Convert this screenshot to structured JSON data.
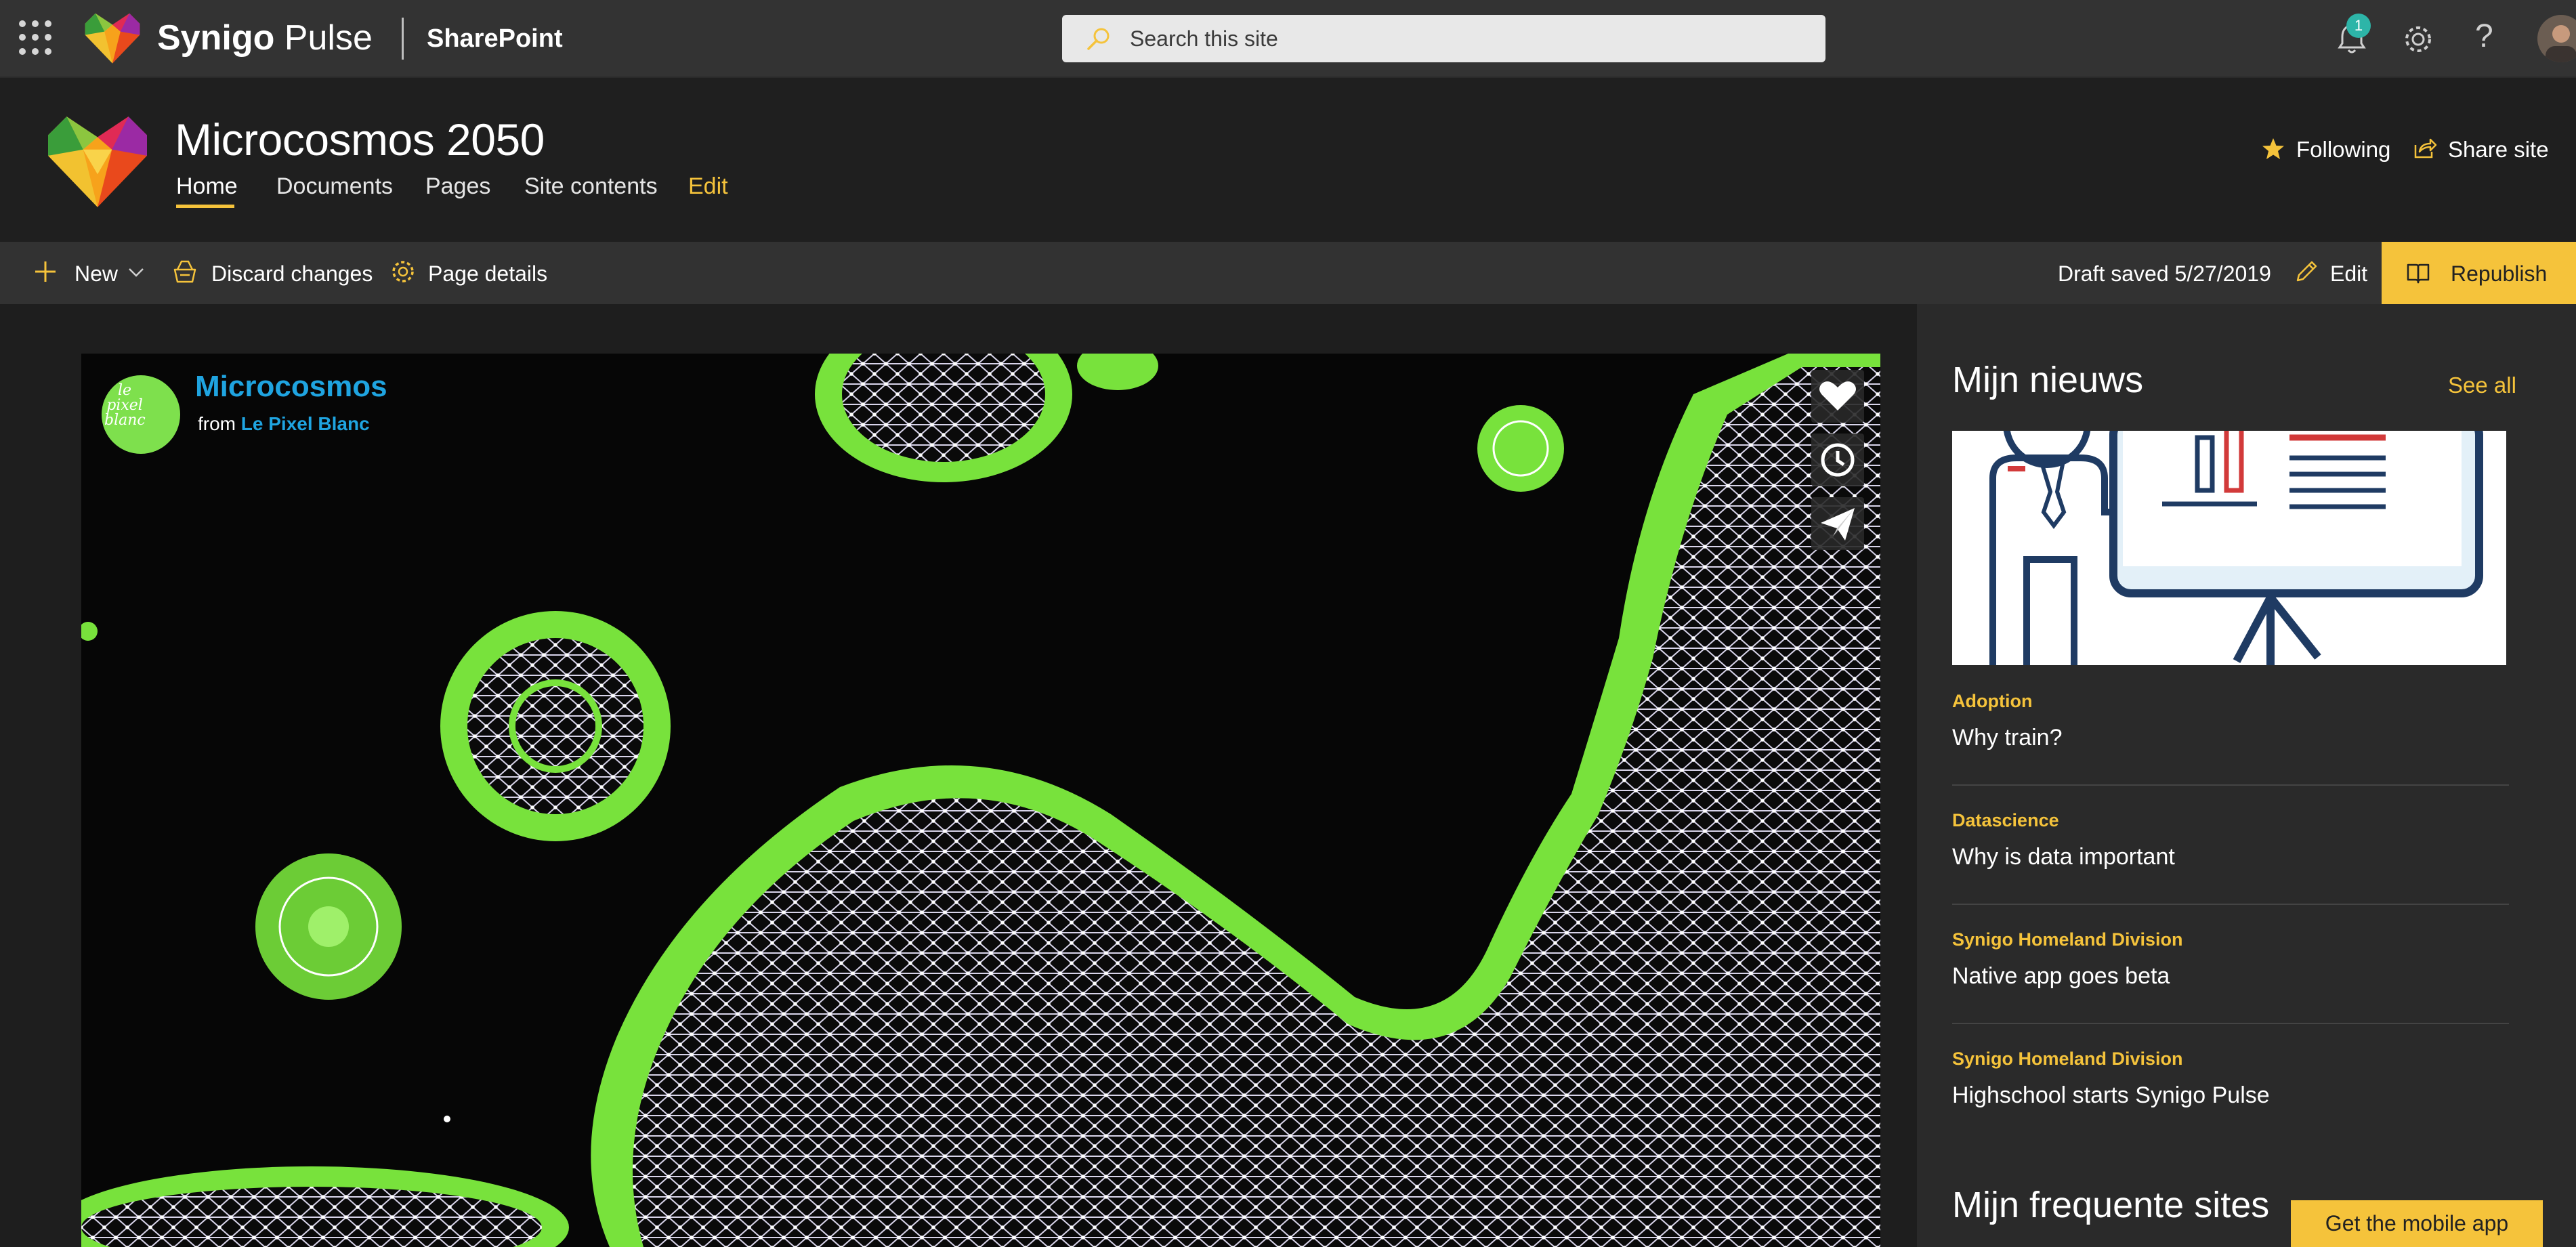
{
  "suite": {
    "brand_bold": "Synigo",
    "brand_light": "Pulse",
    "app_name": "SharePoint",
    "search_placeholder": "Search this site",
    "notification_count": "1",
    "help_label": "?"
  },
  "site": {
    "title": "Microcosmos 2050",
    "nav": [
      "Home",
      "Documents",
      "Pages",
      "Site contents",
      "Edit"
    ],
    "following_label": "Following",
    "share_label": "Share site"
  },
  "command_bar": {
    "new_label": "New",
    "discard_label": "Discard changes",
    "details_label": "Page details",
    "draft_status": "Draft saved 5/27/2019",
    "edit_label": "Edit",
    "republish_label": "Republish"
  },
  "video": {
    "channel_logo_text": "le pixel blanc",
    "title": "Microcosmos",
    "from_label": "from",
    "author": "Le Pixel Blanc"
  },
  "news": {
    "title": "Mijn nieuws",
    "see_all": "See all",
    "items": [
      {
        "category": "Adoption",
        "title": "Why train?"
      },
      {
        "category": "Datascience",
        "title": "Why is data important"
      },
      {
        "category": "Synigo Homeland Division",
        "title": "Native app goes beta"
      },
      {
        "category": "Synigo Homeland Division",
        "title": "Highschool starts Synigo Pulse"
      }
    ]
  },
  "frequent_sites": {
    "title": "Mijn frequente sites"
  },
  "mobile_app": {
    "label": "Get the mobile app"
  },
  "colors": {
    "accent": "#f5c33b",
    "suite_bar": "#333333",
    "link_blue": "#1fa4e0",
    "badge": "#2db5a8"
  },
  "icons": [
    "waffle-icon",
    "search-icon",
    "bell-icon",
    "gear-icon",
    "help-icon",
    "star-icon",
    "share-icon",
    "plus-icon",
    "chevron-down-icon",
    "discard-icon",
    "page-details-icon",
    "edit-icon",
    "republish-icon",
    "heart-icon",
    "clock-icon",
    "send-icon"
  ]
}
